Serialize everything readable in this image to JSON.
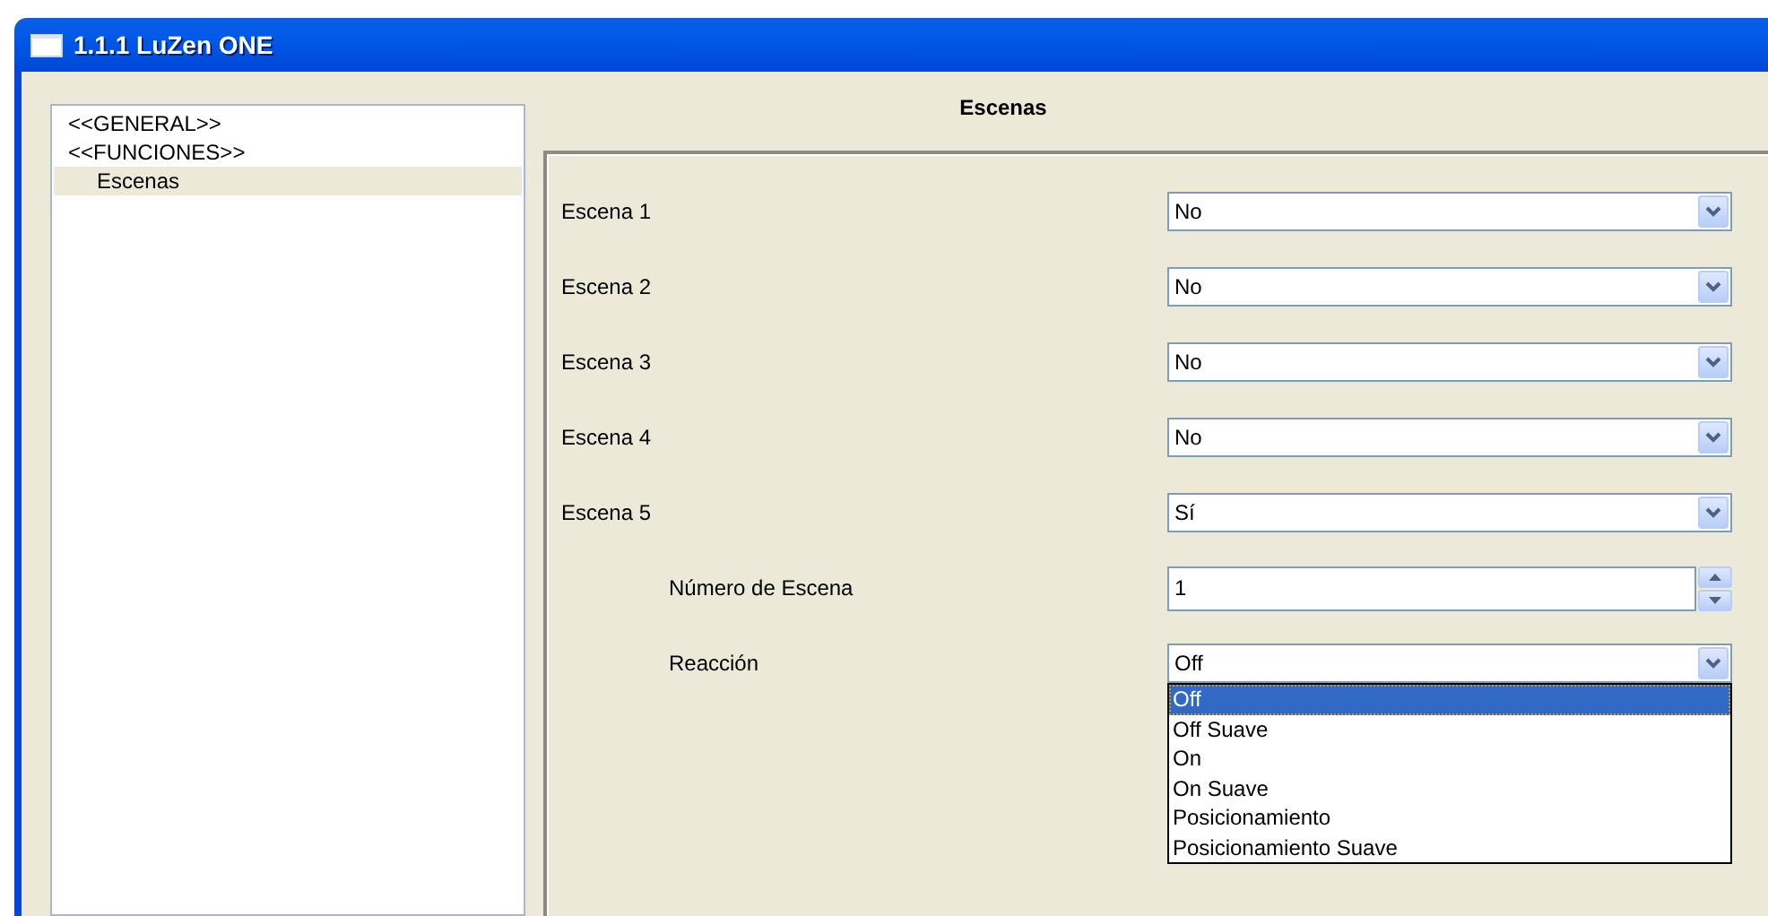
{
  "window": {
    "title": "1.1.1 LuZen ONE"
  },
  "tree": {
    "items": [
      {
        "label": "<<GENERAL>>",
        "selected": false
      },
      {
        "label": "<<FUNCIONES>>",
        "selected": false,
        "children": [
          {
            "label": "Escenas",
            "selected": true
          }
        ]
      }
    ]
  },
  "section": {
    "title": "Escenas"
  },
  "parameters": [
    {
      "label": "Escena 1",
      "kind": "select",
      "value": "No"
    },
    {
      "label": "Escena 2",
      "kind": "select",
      "value": "No"
    },
    {
      "label": "Escena 3",
      "kind": "select",
      "value": "No"
    },
    {
      "label": "Escena 4",
      "kind": "select",
      "value": "No"
    },
    {
      "label": "Escena 5",
      "kind": "select",
      "value": "Sí",
      "children": [
        {
          "label": "Número de Escena",
          "kind": "spin",
          "value": "1"
        },
        {
          "label": "Reacción",
          "kind": "select",
          "value": "Off",
          "options": [
            {
              "label": "Off",
              "selected": true
            },
            {
              "label": "Off Suave",
              "selected": false
            },
            {
              "label": "On",
              "selected": false
            },
            {
              "label": "On Suave",
              "selected": false
            },
            {
              "label": "Posicionamiento",
              "selected": false
            },
            {
              "label": "Posicionamiento Suave",
              "selected": false
            }
          ]
        }
      ]
    }
  ]
}
